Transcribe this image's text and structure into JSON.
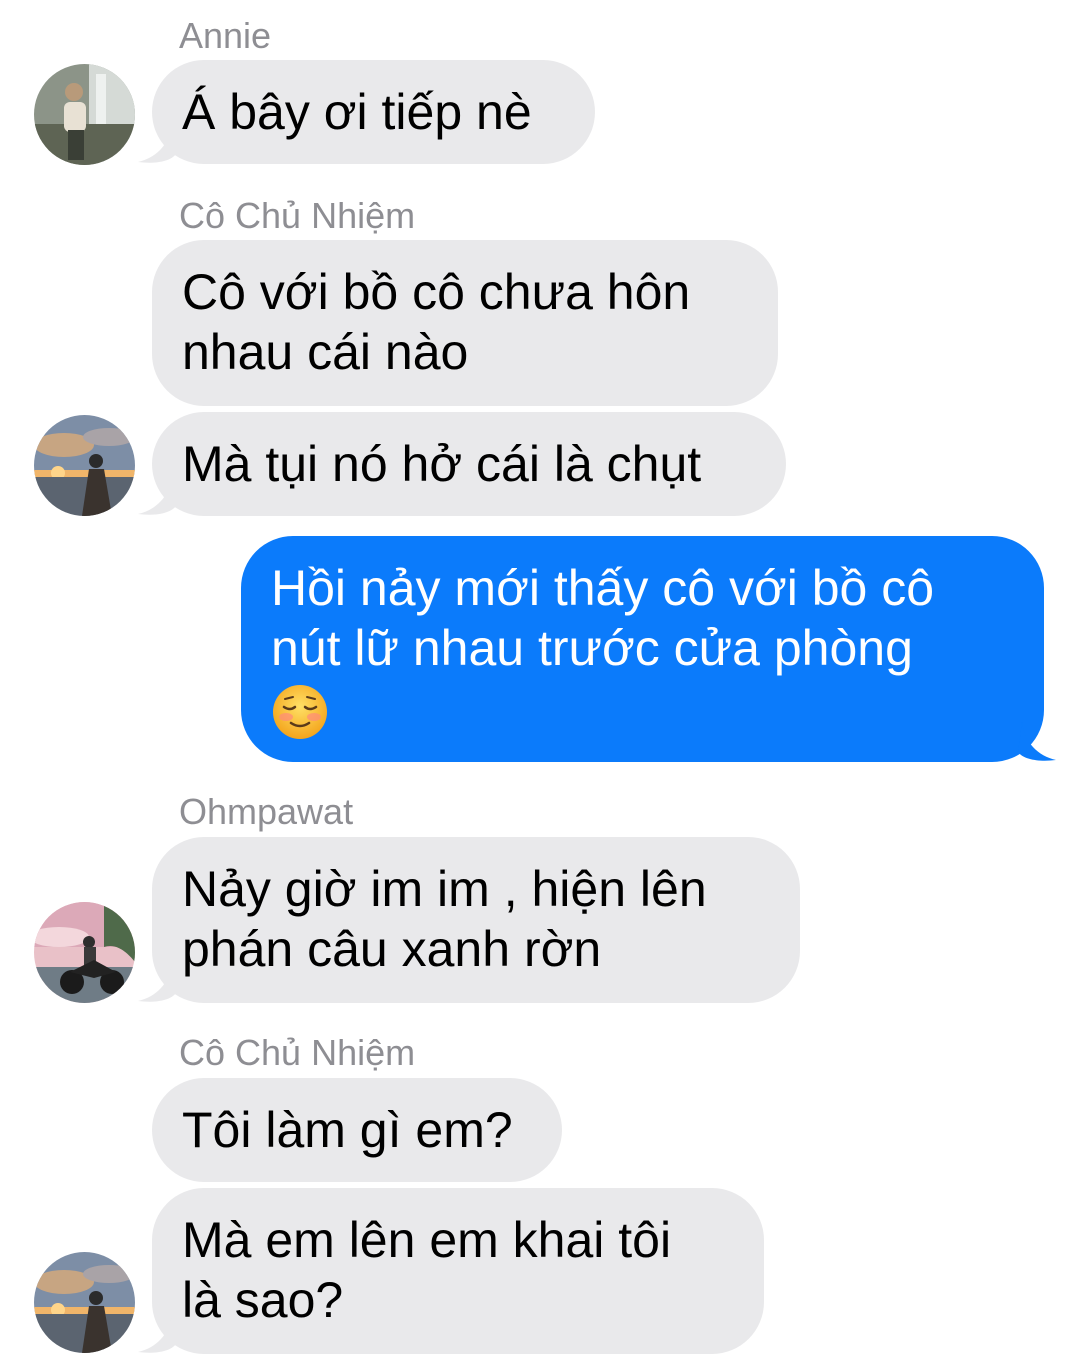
{
  "conversation": {
    "colors": {
      "incoming_bubble": "#e9e9eb",
      "outgoing_bubble": "#0b7bfb",
      "sender_name": "#8e8e93"
    },
    "messages": [
      {
        "sender": "Annie",
        "direction": "incoming",
        "lines": [
          "Á bây ơi tiếp nè"
        ]
      },
      {
        "sender": "Cô Chủ Nhiệm",
        "direction": "incoming",
        "lines": [
          "Cô với bồ cô chưa hôn",
          "nhau cái nào"
        ]
      },
      {
        "sender": "",
        "direction": "incoming",
        "lines": [
          "Mà tụi nó hở cái là chụt"
        ]
      },
      {
        "sender": "",
        "direction": "outgoing",
        "lines": [
          "Hồi nảy mới thấy cô với bồ cô",
          "nút lữ nhau trước cửa phòng"
        ],
        "emoji": "smiling-face-icon"
      },
      {
        "sender": "Ohmpawat",
        "direction": "incoming",
        "lines": [
          "Nảy giờ im im , hiện lên",
          "phán câu xanh rờn"
        ]
      },
      {
        "sender": "Cô Chủ Nhiệm",
        "direction": "incoming",
        "lines": [
          "Tôi làm gì em?"
        ]
      },
      {
        "sender": "",
        "direction": "incoming",
        "lines": [
          "Mà em lên em khai tôi",
          "là sao?"
        ]
      }
    ]
  }
}
